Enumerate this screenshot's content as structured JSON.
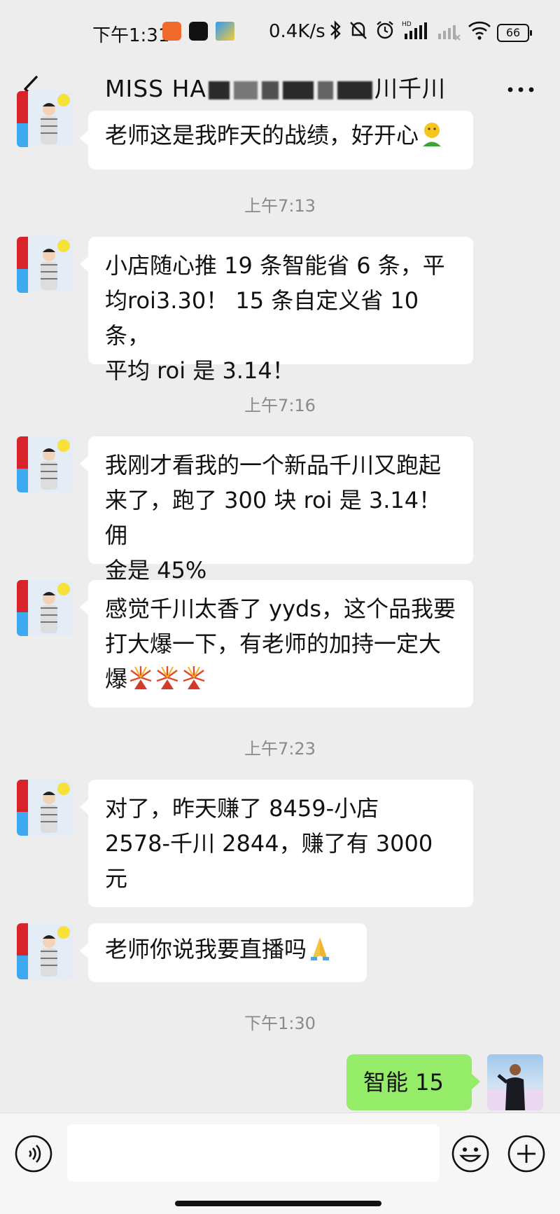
{
  "status_bar": {
    "time": "下午1:31",
    "net_rate": "0.4K/s",
    "battery": "66"
  },
  "header": {
    "title_start": "MISS HA",
    "title_end": "川千川",
    "back_label": "‹",
    "more_label": "···"
  },
  "messages": [
    {
      "type": "text",
      "text": "老师这是我昨天的战绩，好开心"
    },
    {
      "type": "time",
      "text": "上午7:13"
    },
    {
      "type": "text",
      "lines": [
        "小店随心推 19 条智能省 6 条，平",
        "均roi3.30！ 15 条自定义省 10 条，",
        "平均 roi 是 3.14！"
      ]
    },
    {
      "type": "time",
      "text": "上午7:16"
    },
    {
      "type": "text",
      "lines": [
        "我刚才看我的一个新品千川又跑起",
        "来了，跑了 300 块 roi 是 3.14！佣",
        "金是 45%"
      ]
    },
    {
      "type": "text",
      "lines": [
        "感觉千川太香了 yyds，这个品我要",
        "打大爆一下，有老师的加持一定大",
        "爆"
      ]
    },
    {
      "type": "time",
      "text": "上午7:23"
    },
    {
      "type": "text",
      "lines": [
        "对了，昨天赚了 8459-小店",
        "2578-千川 2844，赚了有 3000",
        "元"
      ]
    },
    {
      "type": "text",
      "text": "老师你说我要直播吗"
    },
    {
      "type": "time",
      "text": "下午1:30"
    },
    {
      "type": "mine",
      "text": "智能 15"
    }
  ],
  "icons": {
    "back": "back-arrow-icon",
    "more": "more-icon",
    "voice": "voice-icon",
    "emoji": "emoji-icon",
    "plus": "plus-icon"
  },
  "colors": {
    "background": "#ededed",
    "bubble_other": "#ffffff",
    "bubble_mine": "#95ec69"
  }
}
